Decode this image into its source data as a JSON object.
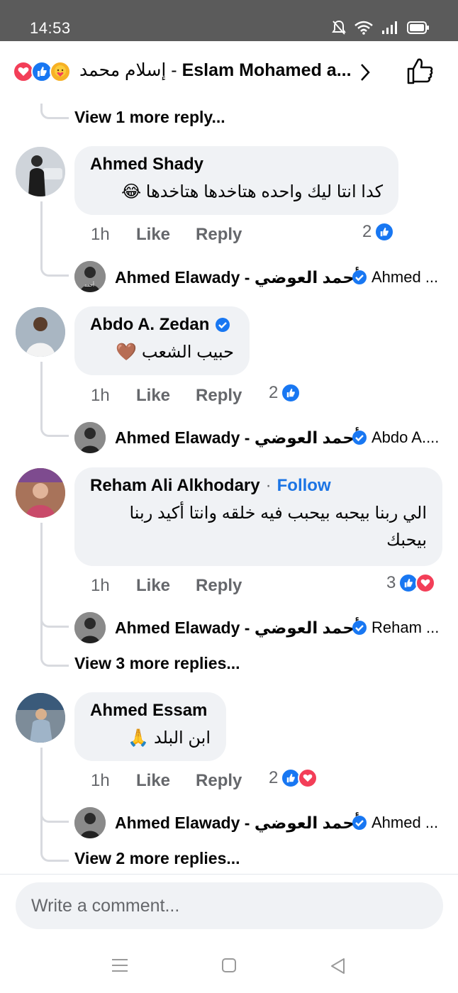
{
  "status_bar": {
    "time": "14:53",
    "icons": [
      "mute-icon",
      "wifi-icon",
      "signal-icon",
      "battery-icon"
    ]
  },
  "header": {
    "title_en": "Eslam Mohamed a...",
    "title_ar": "إسلام محمد - ",
    "reactions": [
      "love",
      "like",
      "care"
    ]
  },
  "colors": {
    "like_blue": "#1877f2",
    "love_red": "#f33e58",
    "verified_blue": "#1877f2",
    "follow_blue": "#1b74e4",
    "bubble_bg": "#f0f2f5"
  },
  "thread": {
    "top_view_more": "View 1 more reply...",
    "comments": [
      {
        "author": "Ahmed Shady",
        "verified": false,
        "follow": "",
        "text": "كدا انتا ليك واحده هتاخدها هتاخدها 😂",
        "time": "1h",
        "like": "Like",
        "reply": "Reply",
        "reaction_count": "2",
        "reactions": [
          "like"
        ],
        "reply_preview": {
          "author_en": "Ahmed Elawady",
          "author_ar": "أحمد العوضي",
          "sep": " - ",
          "text": "Ahmed ..."
        },
        "view_more": ""
      },
      {
        "author": "Abdo A. Zedan",
        "verified": true,
        "follow": "",
        "text": "حبيب الشعب 🤎",
        "time": "1h",
        "like": "Like",
        "reply": "Reply",
        "reaction_count": "2",
        "reactions": [
          "like"
        ],
        "reply_preview": {
          "author_en": "Ahmed Elawady",
          "author_ar": "أحمد العوضي",
          "sep": " - ",
          "text": "Abdo A...."
        },
        "view_more": ""
      },
      {
        "author": "Reham Ali Alkhodary",
        "verified": false,
        "follow": "Follow",
        "text": "الي ربنا بيحبه بيحبب فيه خلقه وانتا أكيد ربنا بيحبك",
        "time": "1h",
        "like": "Like",
        "reply": "Reply",
        "reaction_count": "3",
        "reactions": [
          "like",
          "love"
        ],
        "reply_preview": {
          "author_en": "Ahmed Elawady",
          "author_ar": "أحمد العوضي",
          "sep": " - ",
          "text": "Reham ..."
        },
        "view_more": "View 3 more replies..."
      },
      {
        "author": "Ahmed Essam",
        "verified": false,
        "follow": "",
        "text": "ابن البلد 🙏",
        "time": "1h",
        "like": "Like",
        "reply": "Reply",
        "reaction_count": "2",
        "reactions": [
          "like",
          "love"
        ],
        "reply_preview": {
          "author_en": "Ahmed Elawady",
          "author_ar": "أحمد العوضي",
          "sep": " - ",
          "text": "Ahmed ..."
        },
        "view_more": "View 2 more replies..."
      }
    ]
  },
  "composer": {
    "placeholder": "Write a comment..."
  },
  "nav": [
    "menu-icon",
    "home-square-icon",
    "back-triangle-icon"
  ]
}
